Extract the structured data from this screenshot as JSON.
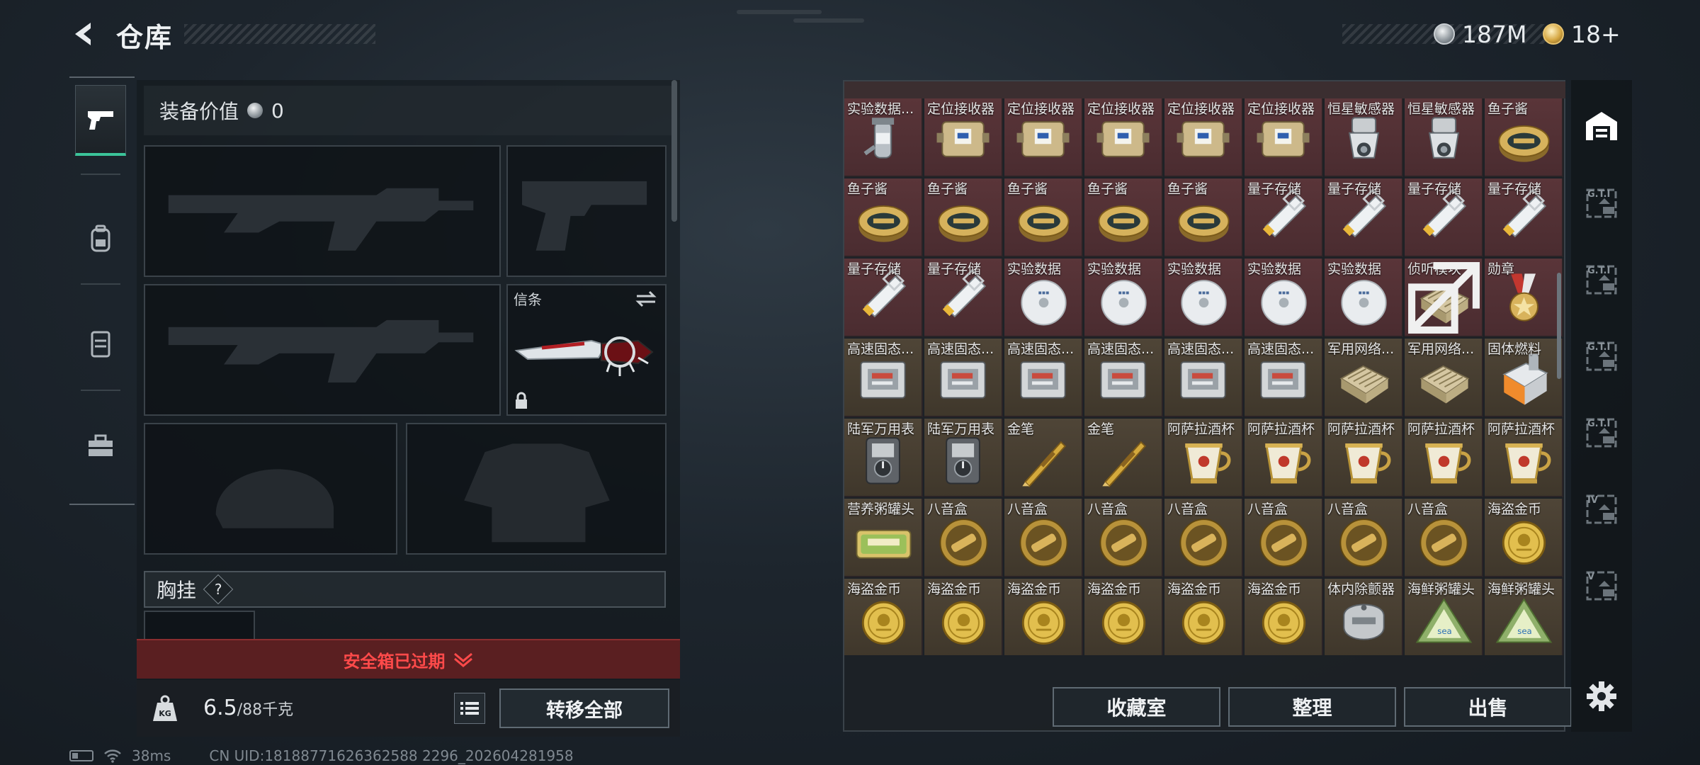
{
  "header": {
    "title": "仓库",
    "currencies": [
      {
        "icon": "silver-coin-icon",
        "value": "187M"
      },
      {
        "icon": "gold-coin-icon",
        "value": "18+"
      }
    ]
  },
  "leftnav": {
    "items": [
      {
        "icon": "pistol-icon",
        "active": true
      },
      {
        "icon": "backpack-icon",
        "active": false
      },
      {
        "icon": "vest-icon",
        "active": false
      },
      {
        "icon": "toolbox-icon",
        "active": false
      }
    ]
  },
  "equipment": {
    "value_label": "装备价值",
    "value": "0",
    "melee_label": "信条",
    "chest_label": "胸挂",
    "chest_badge": "?",
    "expired_text": "安全箱已过期",
    "weight_value": "6.5",
    "weight_max": "/88千克",
    "weight_icon_text": "KG",
    "transfer_all": "转移全部"
  },
  "status": {
    "ping": "38ms",
    "uid": "CN UID:18188771626362588 2296_202604281958"
  },
  "inventory": {
    "rows": [
      [
        {
          "name": "实验数据...",
          "kind": "flask",
          "bg": "red"
        },
        {
          "name": "定位接收器",
          "kind": "receiver",
          "bg": "red"
        },
        {
          "name": "定位接收器",
          "kind": "receiver",
          "bg": "red"
        },
        {
          "name": "定位接收器",
          "kind": "receiver",
          "bg": "red"
        },
        {
          "name": "定位接收器",
          "kind": "receiver",
          "bg": "red"
        },
        {
          "name": "定位接收器",
          "kind": "receiver",
          "bg": "red"
        },
        {
          "name": "恒星敏感器",
          "kind": "sensor",
          "bg": "red"
        },
        {
          "name": "恒星敏感器",
          "kind": "sensor",
          "bg": "red"
        },
        {
          "name": "鱼子酱",
          "kind": "caviar",
          "bg": "red"
        }
      ],
      [
        {
          "name": "鱼子酱",
          "kind": "caviar",
          "bg": "red"
        },
        {
          "name": "鱼子酱",
          "kind": "caviar",
          "bg": "red"
        },
        {
          "name": "鱼子酱",
          "kind": "caviar",
          "bg": "red"
        },
        {
          "name": "鱼子酱",
          "kind": "caviar",
          "bg": "red"
        },
        {
          "name": "鱼子酱",
          "kind": "caviar",
          "bg": "red"
        },
        {
          "name": "量子存储",
          "kind": "usb",
          "bg": "red"
        },
        {
          "name": "量子存储",
          "kind": "usb",
          "bg": "red"
        },
        {
          "name": "量子存储",
          "kind": "usb",
          "bg": "red"
        },
        {
          "name": "量子存储",
          "kind": "usb",
          "bg": "red"
        }
      ],
      [
        {
          "name": "量子存储",
          "kind": "usb",
          "bg": "red"
        },
        {
          "name": "量子存储",
          "kind": "usb",
          "bg": "red"
        },
        {
          "name": "实验数据",
          "kind": "disc",
          "bg": "red"
        },
        {
          "name": "实验数据",
          "kind": "disc",
          "bg": "red"
        },
        {
          "name": "实验数据",
          "kind": "disc",
          "bg": "red"
        },
        {
          "name": "实验数据",
          "kind": "disc",
          "bg": "red"
        },
        {
          "name": "实验数据",
          "kind": "disc",
          "bg": "red"
        },
        {
          "name": "侦听模块",
          "kind": "module",
          "bg": "red",
          "locked": true
        },
        {
          "name": "勋章",
          "kind": "medal",
          "bg": "red"
        }
      ],
      [
        {
          "name": "高速固态...",
          "kind": "ssd",
          "bg": "gold"
        },
        {
          "name": "高速固态...",
          "kind": "ssd",
          "bg": "gold"
        },
        {
          "name": "高速固态...",
          "kind": "ssd",
          "bg": "gold"
        },
        {
          "name": "高速固态...",
          "kind": "ssd",
          "bg": "gold"
        },
        {
          "name": "高速固态...",
          "kind": "ssd",
          "bg": "gold"
        },
        {
          "name": "高速固态...",
          "kind": "ssd",
          "bg": "gold"
        },
        {
          "name": "军用网络...",
          "kind": "module",
          "bg": "gold"
        },
        {
          "name": "军用网络...",
          "kind": "module",
          "bg": "gold"
        },
        {
          "name": "固体燃料",
          "kind": "fuel",
          "bg": "gold"
        }
      ],
      [
        {
          "name": "陆军万用表",
          "kind": "multimeter",
          "bg": "gold"
        },
        {
          "name": "陆军万用表",
          "kind": "multimeter",
          "bg": "gold"
        },
        {
          "name": "金笔",
          "kind": "pen",
          "bg": "gold"
        },
        {
          "name": "金笔",
          "kind": "pen",
          "bg": "gold"
        },
        {
          "name": "阿萨拉酒杯",
          "kind": "cup",
          "bg": "gold"
        },
        {
          "name": "阿萨拉酒杯",
          "kind": "cup",
          "bg": "gold"
        },
        {
          "name": "阿萨拉酒杯",
          "kind": "cup",
          "bg": "gold"
        },
        {
          "name": "阿萨拉酒杯",
          "kind": "cup",
          "bg": "gold"
        },
        {
          "name": "阿萨拉酒杯",
          "kind": "cup",
          "bg": "gold"
        }
      ],
      [
        {
          "name": "营养粥罐头",
          "kind": "tin",
          "bg": "gold"
        },
        {
          "name": "八音盒",
          "kind": "musicbox",
          "bg": "gold"
        },
        {
          "name": "八音盒",
          "kind": "musicbox",
          "bg": "gold"
        },
        {
          "name": "八音盒",
          "kind": "musicbox",
          "bg": "gold"
        },
        {
          "name": "八音盒",
          "kind": "musicbox",
          "bg": "gold"
        },
        {
          "name": "八音盒",
          "kind": "musicbox",
          "bg": "gold"
        },
        {
          "name": "八音盒",
          "kind": "musicbox",
          "bg": "gold"
        },
        {
          "name": "八音盒",
          "kind": "musicbox",
          "bg": "gold"
        },
        {
          "name": "海盗金币",
          "kind": "coin",
          "bg": "gold"
        }
      ],
      [
        {
          "name": "海盗金币",
          "kind": "coin",
          "bg": "gold"
        },
        {
          "name": "海盗金币",
          "kind": "coin",
          "bg": "gold"
        },
        {
          "name": "海盗金币",
          "kind": "coin",
          "bg": "gold"
        },
        {
          "name": "海盗金币",
          "kind": "coin",
          "bg": "gold"
        },
        {
          "name": "海盗金币",
          "kind": "coin",
          "bg": "gold"
        },
        {
          "name": "海盗金币",
          "kind": "coin",
          "bg": "gold"
        },
        {
          "name": "体内除颤器",
          "kind": "defib",
          "bg": "gold"
        },
        {
          "name": "海鲜粥罐头",
          "kind": "seatin",
          "bg": "gold"
        },
        {
          "name": "海鲜粥罐头",
          "kind": "seatin",
          "bg": "gold"
        }
      ]
    ],
    "buttons": {
      "collection": "收藏室",
      "organize": "整理",
      "sell": "出售"
    }
  },
  "rightbar": {
    "items": [
      {
        "icon": "warehouse-icon",
        "text": ""
      },
      {
        "icon": "gti-storage-icon",
        "text": "G.T.I"
      },
      {
        "icon": "gti-storage-icon",
        "text": "G.T.I"
      },
      {
        "icon": "gti-storage-icon",
        "text": "G.T.I"
      },
      {
        "icon": "gti-storage-icon",
        "text": "G.T.I"
      },
      {
        "icon": "iv-storage-icon",
        "text": "IV"
      },
      {
        "icon": "v-storage-icon",
        "text": "V"
      }
    ],
    "settings_icon": "gear-icon"
  }
}
